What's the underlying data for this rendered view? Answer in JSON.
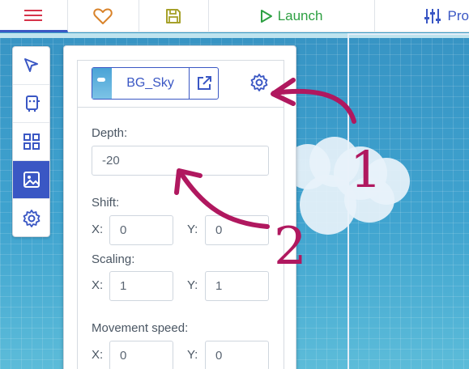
{
  "toolbar": {
    "menu_icon": "hamburger-icon",
    "favorite_icon": "heart-icon",
    "save_icon": "save-icon",
    "launch_label": "Launch",
    "launch_icon": "play-icon",
    "project_label": "Pro",
    "project_icon": "sliders-icon",
    "accent": "#3a57c4",
    "launch_color": "#2ea043",
    "menu_color": "#d6334a",
    "heart_color": "#d9832a",
    "save_color": "#a6a12a"
  },
  "tools": [
    {
      "icon": "cursor-icon",
      "active": false
    },
    {
      "icon": "copy-icon",
      "active": false
    },
    {
      "icon": "tiles-grid-icon",
      "active": false
    },
    {
      "icon": "background-image-icon",
      "active": true
    },
    {
      "icon": "gear-icon",
      "active": false
    }
  ],
  "background": {
    "name": "BG_Sky",
    "open_icon": "external-link-icon",
    "settings_icon": "gear-icon"
  },
  "properties": {
    "depth_label": "Depth:",
    "depth_value": "-20",
    "shift_label": "Shift:",
    "shift_x_label": "X:",
    "shift_x": "0",
    "shift_y_label": "Y:",
    "shift_y": "0",
    "scaling_label": "Scaling:",
    "scaling_x_label": "X:",
    "scaling_x": "1",
    "scaling_y_label": "Y:",
    "scaling_y": "1",
    "movement_label": "Movement speed:",
    "movement_x_label": "X:",
    "movement_x": "0",
    "movement_y_label": "Y:",
    "movement_y": "0"
  },
  "annotations": {
    "mark_1": "1",
    "mark_2": "2",
    "color": "#b0185f"
  }
}
